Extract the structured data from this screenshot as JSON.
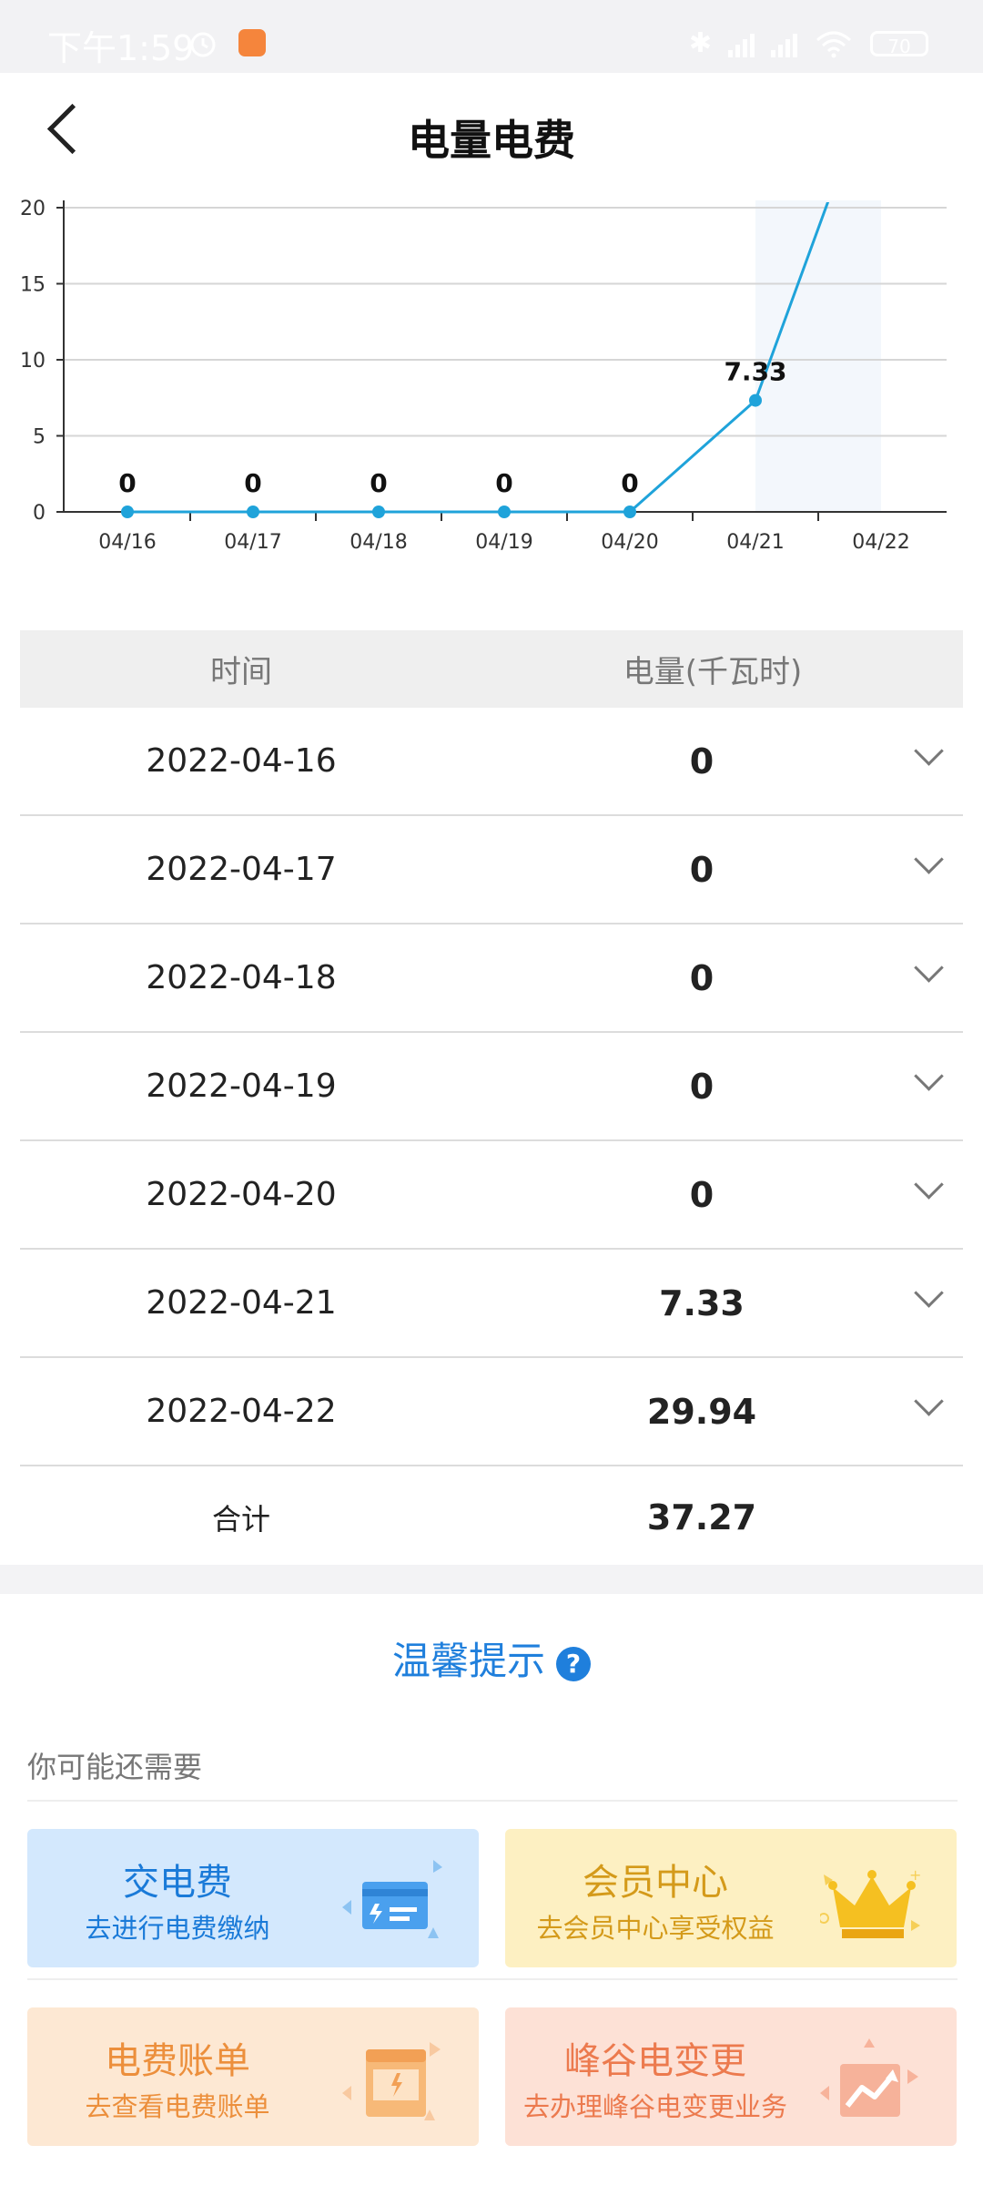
{
  "status_bar": {
    "time": "下午1:59",
    "battery": "70"
  },
  "header": {
    "title": "电量电费"
  },
  "chart_data": {
    "type": "area",
    "categories": [
      "04/16",
      "04/17",
      "04/18",
      "04/19",
      "04/20",
      "04/21",
      "04/22"
    ],
    "values": [
      0,
      0,
      0,
      0,
      0,
      7.33,
      29.94
    ],
    "data_labels": [
      "0",
      "0",
      "0",
      "0",
      "0",
      "7.33",
      ""
    ],
    "y_ticks": [
      "0",
      "5",
      "10",
      "15",
      "20"
    ],
    "ylim": [
      0,
      20
    ],
    "grid": true,
    "line_color": "#1fa3da",
    "highlight_fill": "#f3f7fc"
  },
  "table": {
    "headers": [
      "时间",
      "电量(千瓦时)"
    ],
    "rows": [
      {
        "date": "2022-04-16",
        "value": "0"
      },
      {
        "date": "2022-04-17",
        "value": "0"
      },
      {
        "date": "2022-04-18",
        "value": "0"
      },
      {
        "date": "2022-04-19",
        "value": "0"
      },
      {
        "date": "2022-04-20",
        "value": "0"
      },
      {
        "date": "2022-04-21",
        "value": "7.33"
      },
      {
        "date": "2022-04-22",
        "value": "29.94"
      }
    ],
    "total_label": "合计",
    "total_value": "37.27"
  },
  "tip": {
    "label": "温馨提示",
    "help_glyph": "?"
  },
  "services": {
    "heading": "你可能还需要",
    "cards": [
      {
        "title": "交电费",
        "subtitle": "去进行电费缴纳",
        "icon": "card-payment-icon"
      },
      {
        "title": "会员中心",
        "subtitle": "去会员中心享受权益",
        "icon": "crown-icon"
      },
      {
        "title": "电费账单",
        "subtitle": "去查看电费账单",
        "icon": "bill-icon"
      },
      {
        "title": "峰谷电变更",
        "subtitle": "去办理峰谷电变更业务",
        "icon": "trend-chart-icon"
      }
    ]
  }
}
